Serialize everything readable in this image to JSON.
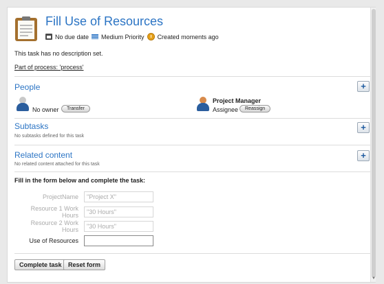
{
  "task": {
    "title": "Fill Use of Resources",
    "due": "No due date",
    "priority": "Medium Priority",
    "created": "Created moments ago",
    "description": "This task has no description set.",
    "process_link": "Part of process: 'process'"
  },
  "people": {
    "title": "People",
    "owner_label": "No owner",
    "transfer_label": "Transfer",
    "assignee_name": "Project Manager",
    "assignee_label": "Assignee",
    "reassign_label": "Reassign"
  },
  "subtasks": {
    "title": "Subtasks",
    "note": "No subtasks defined for this task"
  },
  "related": {
    "title": "Related content",
    "note": "No related content attached for this task"
  },
  "form": {
    "title": "Fill in the form below and complete the task:",
    "fields": [
      {
        "label": "ProjectName",
        "value": "\"Project X\""
      },
      {
        "label": "Resource 1 Work Hours",
        "value": "\"30 Hours\""
      },
      {
        "label": "Resource 2 Work Hours",
        "value": "\"30 Hours\""
      },
      {
        "label": "Use of Resources",
        "value": ""
      }
    ],
    "complete_label": "Complete task",
    "reset_label": "Reset form"
  },
  "colors": {
    "accent": "#2b74c4"
  }
}
